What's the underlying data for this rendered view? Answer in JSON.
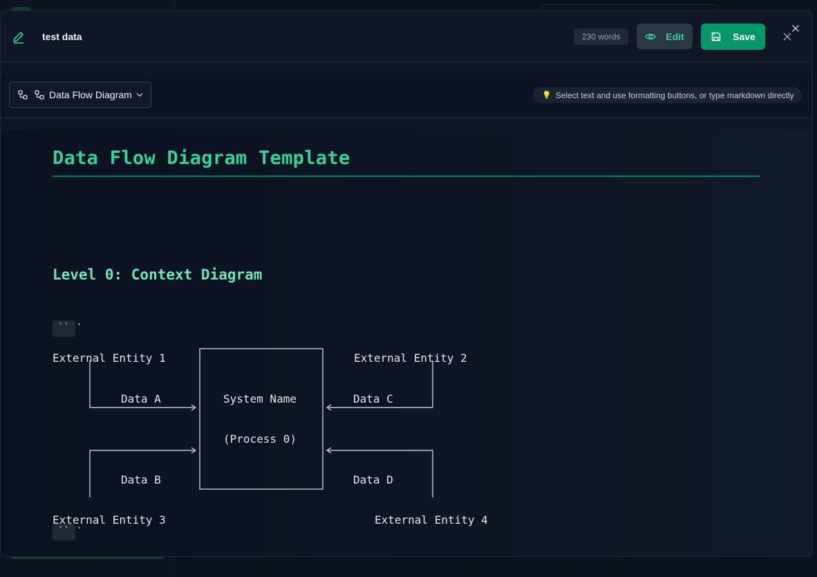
{
  "header": {
    "title": "test data",
    "word_count": "230 words",
    "edit_label": "Edit",
    "save_label": "Save"
  },
  "toolbar": {
    "template_label": "Data Flow Diagram",
    "hint_icon": "💡",
    "hint_text": "Select text and use formatting buttons, or type markdown directly"
  },
  "document": {
    "h1": "Data Flow Diagram Template",
    "h2": "Level 0: Context Diagram",
    "fence_code": "``",
    "fence_tick": "`",
    "diagram": {
      "entity1": "External Entity 1",
      "entity2": "External Entity 2",
      "entity3": "External Entity 3",
      "entity4": "External Entity 4",
      "data_a": "Data A",
      "data_b": "Data B",
      "data_c": "Data C",
      "data_d": "Data D",
      "system_name": "System Name",
      "process": "(Process 0)"
    }
  },
  "colors": {
    "accent": "#10b981",
    "save_bg": "#059669",
    "heading": "#34d399"
  },
  "icons": [
    "pencil-icon",
    "eye-icon",
    "save-icon",
    "close-icon",
    "diagram-icon",
    "chevron-down-icon",
    "lightbulb-icon"
  ]
}
